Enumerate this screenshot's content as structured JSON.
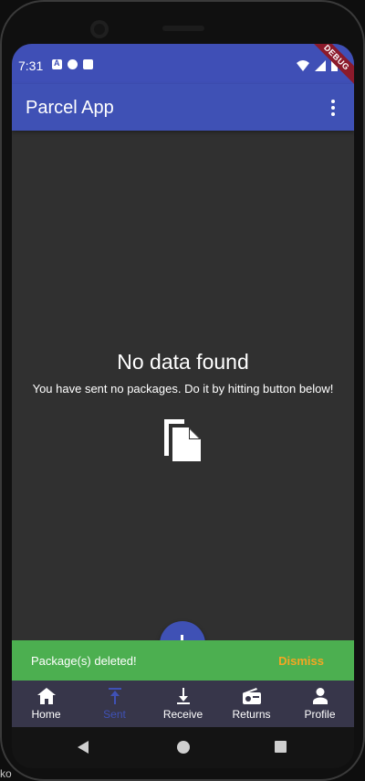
{
  "status_bar": {
    "time": "7:31",
    "debug_label": "DEBUG"
  },
  "app_bar": {
    "title": "Parcel App",
    "menu_icon": "more-vert-icon"
  },
  "empty_state": {
    "title": "No data found",
    "subtitle": "You have sent no packages. Do it by hitting button below!",
    "icon": "copy-document-icon"
  },
  "snackbar": {
    "message": "Package(s) deleted!",
    "action": "Dismiss"
  },
  "bottom_nav": {
    "items": [
      {
        "label": "Home",
        "icon": "home-icon"
      },
      {
        "label": "Sent",
        "icon": "upload-icon",
        "active": true
      },
      {
        "label": "Receive",
        "icon": "download-icon"
      },
      {
        "label": "Returns",
        "icon": "radio-icon"
      },
      {
        "label": "Profile",
        "icon": "person-icon"
      }
    ]
  },
  "corner_text": "ko",
  "colors": {
    "status_bar": "#3f4fb6",
    "app_bar": "#3f51b5",
    "background": "#303030",
    "snackbar": "#4caf50",
    "snackbar_action": "#f5a623",
    "bottom_nav": "#37364a",
    "active_nav": "#3f51b5"
  }
}
